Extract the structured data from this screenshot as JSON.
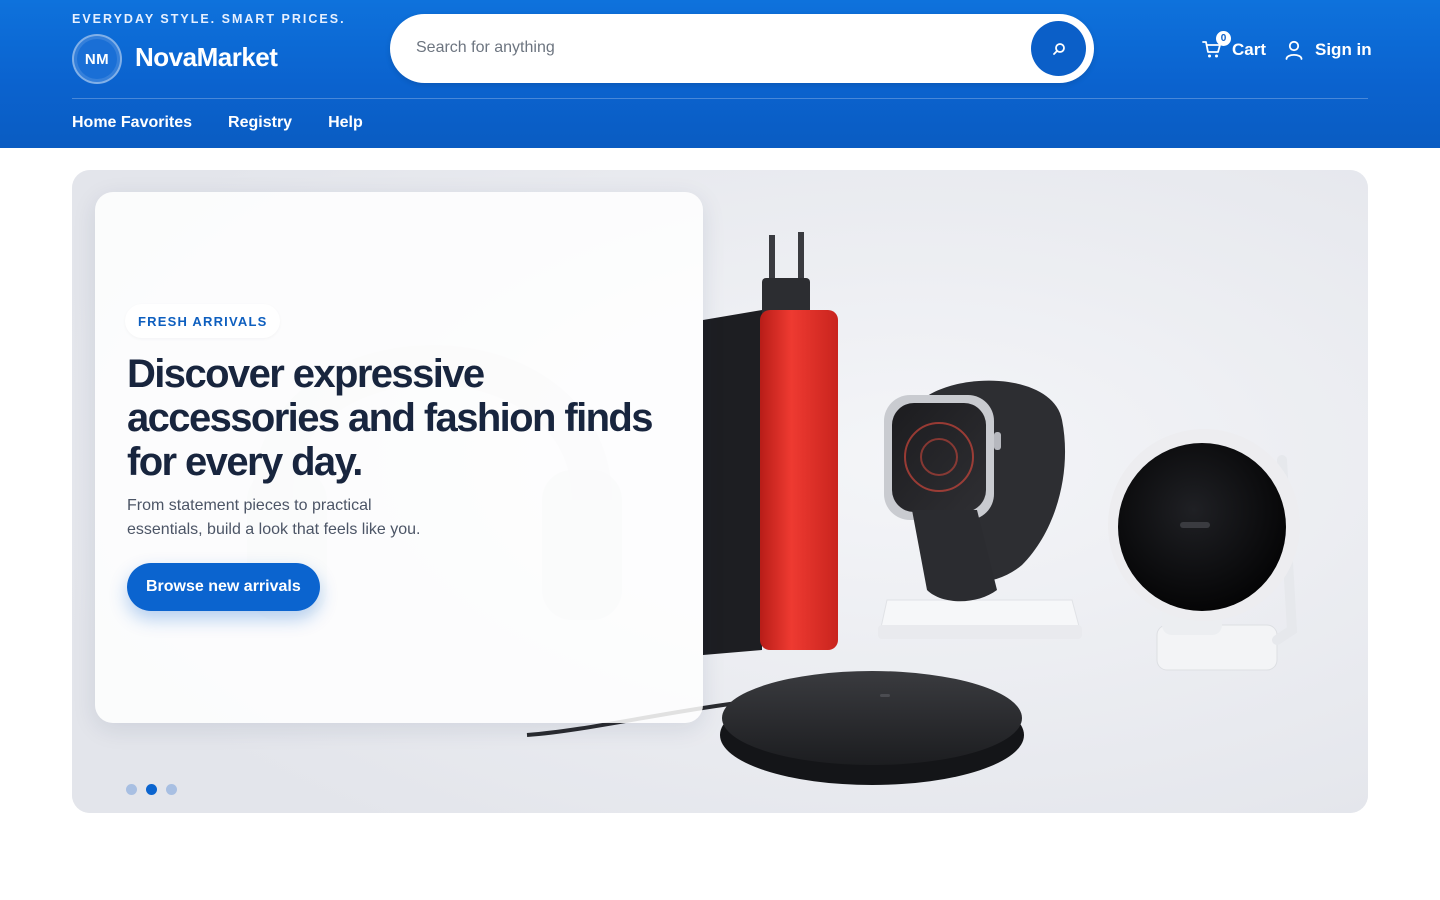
{
  "header": {
    "tagline": "EVERYDAY STYLE. SMART PRICES.",
    "logo_initials": "NM",
    "brand": "NovaMarket",
    "search": {
      "placeholder": "Search for anything",
      "value": ""
    },
    "cart": {
      "label": "Cart",
      "count": "0"
    },
    "signin_label": "Sign in",
    "nav": [
      "Home Favorites",
      "Registry",
      "Help"
    ]
  },
  "hero": {
    "eyebrow": "FRESH ARRIVALS",
    "title": "Discover expressive accessories and fashion finds for every day.",
    "subtitle": "From statement pieces to practical essentials, build a look that feels like you.",
    "cta_label": "Browse new arrivals",
    "carousel": {
      "total": 3,
      "active_index": 2
    }
  },
  "colors": {
    "header_blue": "#0b63cf",
    "accent": "#0b64cf",
    "charger_red": "#e8322b",
    "text_dark": "#18253e"
  },
  "icons": [
    "search-icon",
    "cart-icon",
    "user-icon"
  ]
}
